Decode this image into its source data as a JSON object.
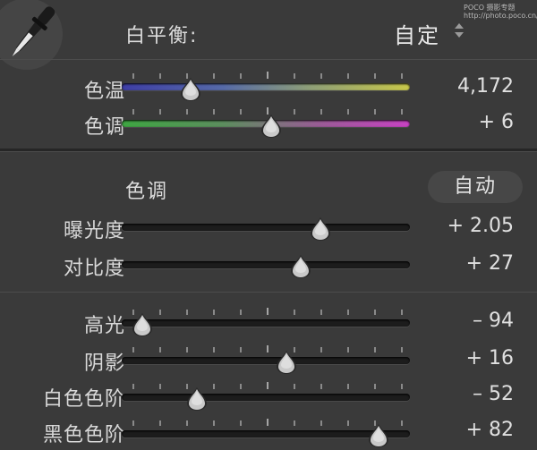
{
  "white_balance": {
    "label": "白平衡:",
    "preset": "自定",
    "sliders": [
      {
        "label": "色温",
        "value_text": "4,172",
        "level": 0.24
      },
      {
        "label": "色调",
        "value_text": "+ 6",
        "level": 0.52
      }
    ]
  },
  "tone": {
    "label": "色调",
    "auto_label": "自动",
    "sliders": [
      {
        "label": "曝光度",
        "value_text": "+ 2.05",
        "level": 0.69
      },
      {
        "label": "对比度",
        "value_text": "+ 27",
        "level": 0.62
      },
      {
        "label": "高光",
        "value_text": "– 94",
        "level": 0.07
      },
      {
        "label": "阴影",
        "value_text": "+ 16",
        "level": 0.57
      },
      {
        "label": "白色色阶",
        "value_text": "– 52",
        "level": 0.26
      },
      {
        "label": "黑色色阶",
        "value_text": "+ 82",
        "level": 0.89
      }
    ]
  },
  "watermark": {
    "line1": "POCO 摄影专题",
    "line2": "http://photo.poco.cn/"
  },
  "icons": {
    "eyedropper": "eyedropper-icon",
    "stepper": "up-down-arrows-icon"
  },
  "colors": {
    "background": "#3a3a3a",
    "track": "#1c1c1c",
    "thumb": "#c9c9c9"
  }
}
